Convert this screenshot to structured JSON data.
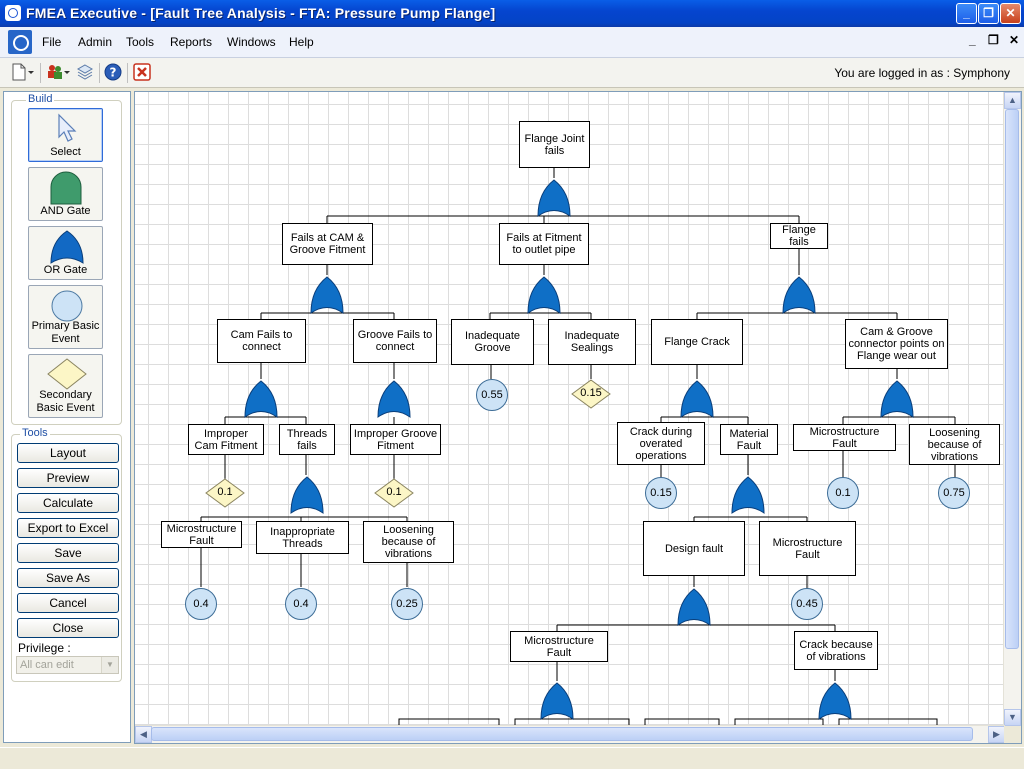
{
  "window": {
    "title": "FMEA Executive - [Fault Tree Analysis - FTA: Pressure Pump Flange]",
    "minimize": "_",
    "restore": "❐",
    "close": "✕"
  },
  "menubar": {
    "items": [
      "File",
      "Admin",
      "Tools",
      "Reports",
      "Windows",
      "Help"
    ],
    "mdi_min": "_",
    "mdi_restore": "❐",
    "mdi_close": "✕"
  },
  "toolbar": {
    "login_text": "You are logged in as : Symphony",
    "icons": [
      "new-document-icon",
      "users-icon",
      "layers-icon",
      "help-icon",
      "close-red-icon"
    ]
  },
  "build": {
    "label": "Build",
    "buttons": [
      {
        "label": "Select",
        "icon": "pointer-arrow-icon"
      },
      {
        "label": "AND Gate",
        "icon": "and-gate-icon"
      },
      {
        "label": "OR Gate",
        "icon": "or-gate-icon"
      },
      {
        "label": "Primary Basic Event",
        "icon": "circle-icon"
      },
      {
        "label": "Secondary Basic Event",
        "icon": "diamond-icon"
      }
    ]
  },
  "tools": {
    "label": "Tools",
    "buttons": [
      "Layout",
      "Preview",
      "Calculate",
      "Export to Excel",
      "Save",
      "Save As",
      "Cancel",
      "Close"
    ],
    "privilege_label": "Privilege :",
    "privilege_value": "All can edit"
  },
  "colors": {
    "gate": "#0f6fc6",
    "primary_event": "#cde3f6",
    "secondary_event": "#fcf6c6"
  },
  "tree": {
    "top": "Flange Joint fails",
    "l1": [
      "Fails at CAM & Groove Fitment",
      "Fails at Fitment to outlet pipe",
      "Flange fails"
    ],
    "l2": [
      "Cam Fails to connect",
      "Groove Fails to connect",
      "Inadequate Groove",
      "Inadequate Sealings",
      "Flange Crack",
      "Cam & Groove connector points on Flange wear out"
    ],
    "l3": [
      "Improper Cam Fitment",
      "Threads fails",
      "Improper Groove Fitment",
      "Crack during overated operations",
      "Material Fault",
      "Microstructure Fault",
      "Loosening because of vibrations"
    ],
    "l4": [
      "Microstructure Fault",
      "Inappropriate Threads",
      "Loosening because of vibrations",
      "Design fault",
      "Microstructure Fault"
    ],
    "l5": [
      "Microstructure Fault",
      "Crack because of vibrations"
    ],
    "values": {
      "inadequate_groove": "0.55",
      "inadequate_sealings": "0.15",
      "improper_cam": "0.1",
      "improper_groove": "0.1",
      "crack_overated": "0.15",
      "micro_right": "0.1",
      "loosening_right": "0.75",
      "micro_left": "0.4",
      "inappropriate_threads": "0.4",
      "loosening_left": "0.25",
      "micro_material": "0.45"
    }
  }
}
